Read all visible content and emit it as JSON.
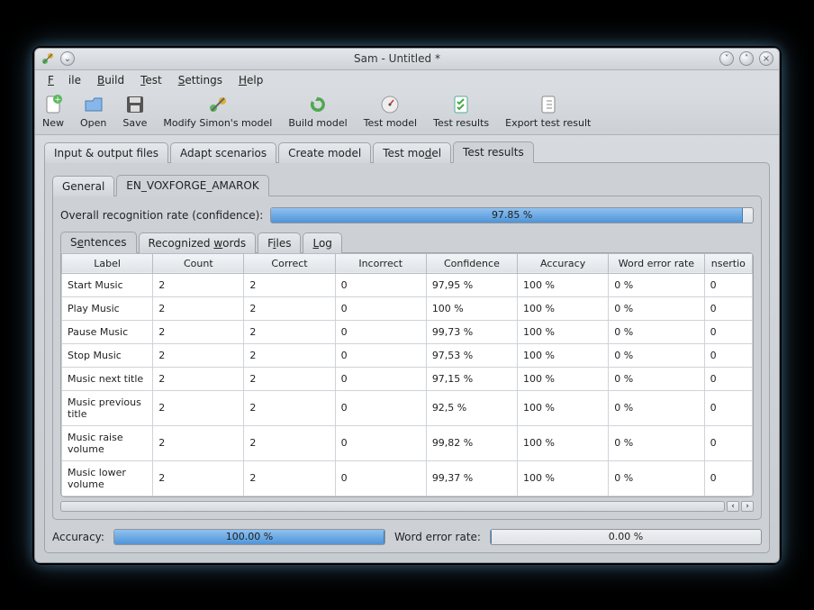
{
  "window": {
    "title": "Sam - Untitled *"
  },
  "menu": {
    "file": "File",
    "build": "Build",
    "test": "Test",
    "settings": "Settings",
    "help": "Help"
  },
  "toolbar": {
    "new": "New",
    "open": "Open",
    "save": "Save",
    "modify": "Modify Simon's model",
    "build": "Build model",
    "test": "Test model",
    "results": "Test results",
    "export": "Export test result"
  },
  "mainTabs": {
    "io": "Input & output files",
    "adapt": "Adapt scenarios",
    "create": "Create model",
    "testmodel": "Test model",
    "results": "Test results"
  },
  "subTabs": {
    "general": "General",
    "vox": "EN_VOXFORGE_AMAROK"
  },
  "overall": {
    "label": "Overall recognition rate (confidence):",
    "text": "97.85 %",
    "pct": 97.85
  },
  "innerTabs": {
    "sentences": "Sentences",
    "words": "Recognized words",
    "files": "Files",
    "log": "Log"
  },
  "columns": {
    "label": "Label",
    "count": "Count",
    "correct": "Correct",
    "incorrect": "Incorrect",
    "confidence": "Confidence",
    "accuracy": "Accuracy",
    "wer": "Word error rate",
    "ins": "nsertio"
  },
  "rows": [
    {
      "label": "Start Music",
      "count": "2",
      "correct": "2",
      "incorrect": "0",
      "confidence": "97,95 %",
      "accuracy": "100 %",
      "wer": "0 %",
      "ins": "0"
    },
    {
      "label": "Play Music",
      "count": "2",
      "correct": "2",
      "incorrect": "0",
      "confidence": "100 %",
      "accuracy": "100 %",
      "wer": "0 %",
      "ins": "0"
    },
    {
      "label": "Pause Music",
      "count": "2",
      "correct": "2",
      "incorrect": "0",
      "confidence": "99,73 %",
      "accuracy": "100 %",
      "wer": "0 %",
      "ins": "0"
    },
    {
      "label": "Stop Music",
      "count": "2",
      "correct": "2",
      "incorrect": "0",
      "confidence": "97,53 %",
      "accuracy": "100 %",
      "wer": "0 %",
      "ins": "0"
    },
    {
      "label": "Music next title",
      "count": "2",
      "correct": "2",
      "incorrect": "0",
      "confidence": "97,15 %",
      "accuracy": "100 %",
      "wer": "0 %",
      "ins": "0"
    },
    {
      "label": "Music previous title",
      "count": "2",
      "correct": "2",
      "incorrect": "0",
      "confidence": "92,5 %",
      "accuracy": "100 %",
      "wer": "0 %",
      "ins": "0"
    },
    {
      "label": "Music raise volume",
      "count": "2",
      "correct": "2",
      "incorrect": "0",
      "confidence": "99,82 %",
      "accuracy": "100 %",
      "wer": "0 %",
      "ins": "0"
    },
    {
      "label": "Music lower volume",
      "count": "2",
      "correct": "2",
      "incorrect": "0",
      "confidence": "99,37 %",
      "accuracy": "100 %",
      "wer": "0 %",
      "ins": "0"
    }
  ],
  "footer": {
    "accLabel": "Accuracy:",
    "accText": "100.00 %",
    "accPct": 100,
    "werLabel": "Word error rate:",
    "werText": "0.00 %",
    "werPct": 0
  },
  "chart_data": {
    "type": "table",
    "title": "Test results – Sentences",
    "columns": [
      "Label",
      "Count",
      "Correct",
      "Incorrect",
      "Confidence",
      "Accuracy",
      "Word error rate",
      "Insertions"
    ],
    "rows": [
      [
        "Start Music",
        2,
        2,
        0,
        97.95,
        100,
        0,
        0
      ],
      [
        "Play Music",
        2,
        2,
        0,
        100,
        100,
        0,
        0
      ],
      [
        "Pause Music",
        2,
        2,
        0,
        99.73,
        100,
        0,
        0
      ],
      [
        "Stop Music",
        2,
        2,
        0,
        97.53,
        100,
        0,
        0
      ],
      [
        "Music next title",
        2,
        2,
        0,
        97.15,
        100,
        0,
        0
      ],
      [
        "Music previous title",
        2,
        2,
        0,
        92.5,
        100,
        0,
        0
      ],
      [
        "Music raise volume",
        2,
        2,
        0,
        99.82,
        100,
        0,
        0
      ],
      [
        "Music lower volume",
        2,
        2,
        0,
        99.37,
        100,
        0,
        0
      ]
    ],
    "summary": {
      "overall_recognition_rate_pct": 97.85,
      "accuracy_pct": 100.0,
      "word_error_rate_pct": 0.0
    }
  }
}
